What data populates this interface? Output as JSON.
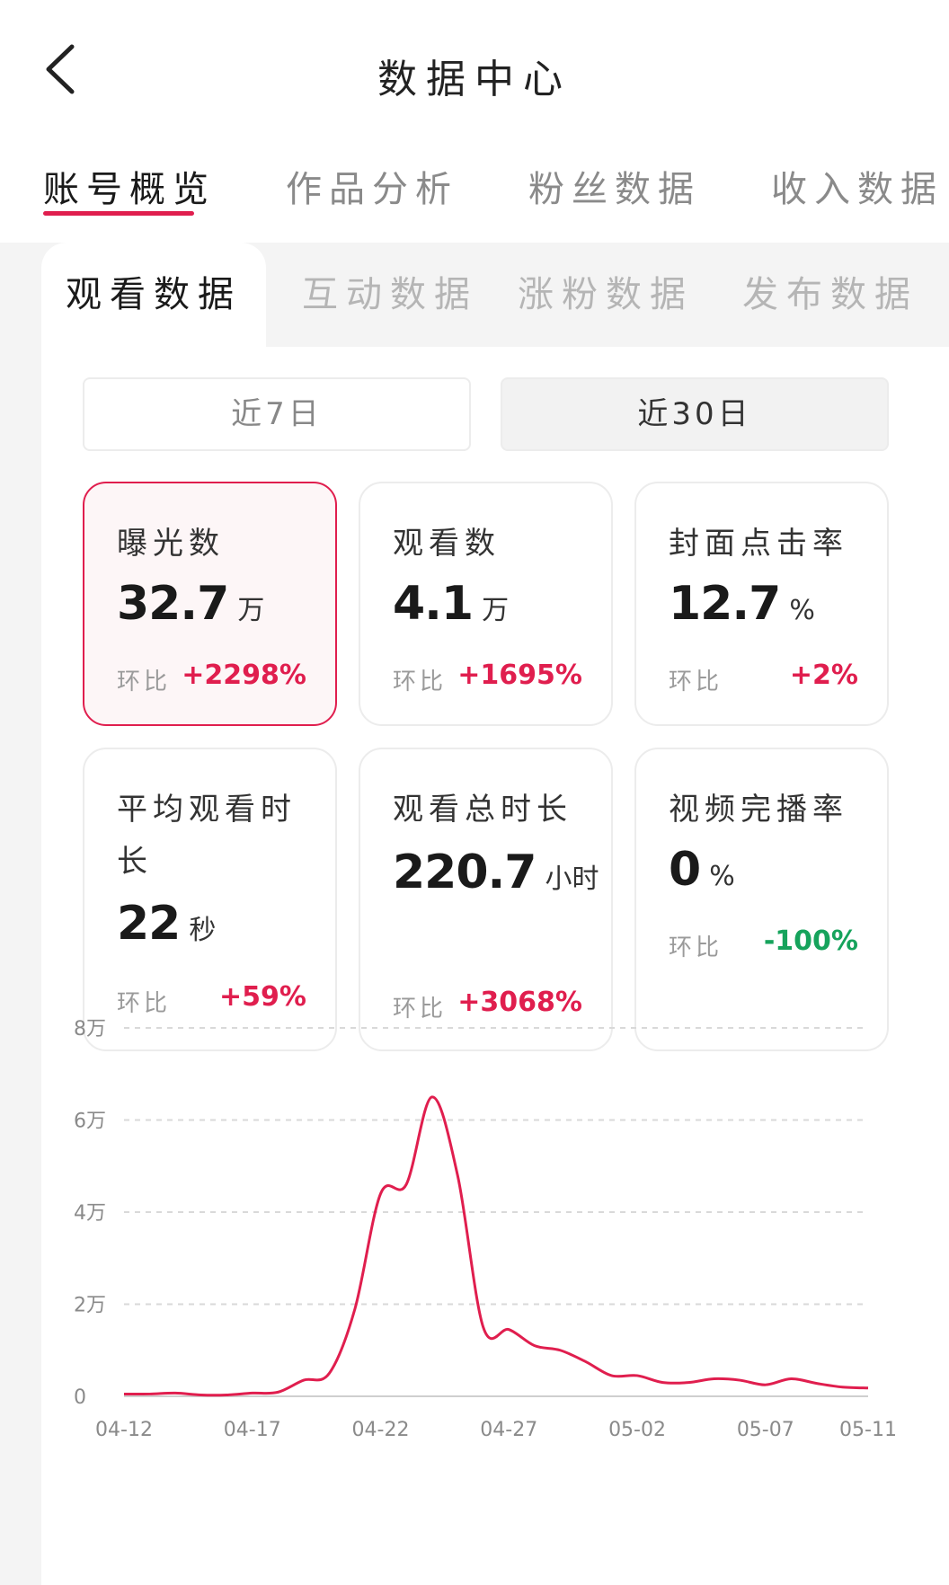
{
  "header": {
    "title": "数据中心"
  },
  "main_tabs": [
    {
      "label": "账号概览",
      "active": true
    },
    {
      "label": "作品分析",
      "active": false
    },
    {
      "label": "粉丝数据",
      "active": false
    },
    {
      "label": "收入数据",
      "active": false
    }
  ],
  "sub_tabs": [
    {
      "label": "观看数据",
      "active": true
    },
    {
      "label": "互动数据",
      "active": false
    },
    {
      "label": "涨粉数据",
      "active": false
    },
    {
      "label": "发布数据",
      "active": false
    }
  ],
  "range": {
    "option_7": "近7日",
    "option_30": "近30日",
    "selected": "近30日"
  },
  "metrics": [
    {
      "label": "曝光数",
      "value": "32.7",
      "unit": "万",
      "compare_label": "环比",
      "change": "+2298%",
      "selected": true
    },
    {
      "label": "观看数",
      "value": "4.1",
      "unit": "万",
      "compare_label": "环比",
      "change": "+1695%"
    },
    {
      "label": "封面点击率",
      "value": "12.7",
      "unit": "%",
      "compare_label": "环比",
      "change": "+2%"
    },
    {
      "label": "平均观看时长",
      "value": "22",
      "unit": "秒",
      "compare_label": "环比",
      "change": "+59%"
    },
    {
      "label": "观看总时长",
      "value": "220.7",
      "unit": "小时",
      "compare_label": "环比",
      "change": "+3068%"
    },
    {
      "label": "视频完播率",
      "value": "0",
      "unit": "%",
      "compare_label": "环比",
      "change": "-100%"
    }
  ],
  "colors": {
    "accent": "#e01e4e",
    "negative": "#16a35c",
    "grid": "#d9d9d9"
  },
  "chart_data": {
    "type": "line",
    "ylim": [
      0,
      80000
    ],
    "y_ticks": [
      {
        "value": 0,
        "label": "0"
      },
      {
        "value": 20000,
        "label": "2万"
      },
      {
        "value": 40000,
        "label": "4万"
      },
      {
        "value": 60000,
        "label": "6万"
      },
      {
        "value": 80000,
        "label": "8万"
      }
    ],
    "x_tick_labels": [
      "04-12",
      "04-17",
      "04-22",
      "04-27",
      "05-02",
      "05-07",
      "05-11"
    ],
    "grid": true,
    "series": [
      {
        "x": [
          "04-12",
          "04-13",
          "04-14",
          "04-15",
          "04-16",
          "04-17",
          "04-18",
          "04-19",
          "04-20",
          "04-21",
          "04-22",
          "04-23",
          "04-24",
          "04-25",
          "04-26",
          "04-27",
          "04-28",
          "04-29",
          "04-30",
          "05-01",
          "05-02",
          "05-03",
          "05-04",
          "05-05",
          "05-06",
          "05-07",
          "05-08",
          "05-09",
          "05-10",
          "05-11"
        ],
        "y": [
          500,
          500,
          700,
          300,
          300,
          700,
          900,
          3500,
          5000,
          19000,
          44000,
          46000,
          65000,
          48000,
          15000,
          14500,
          11000,
          10000,
          7500,
          4500,
          4500,
          3000,
          3000,
          3800,
          3500,
          2500,
          3800,
          2800,
          2000,
          1800
        ]
      }
    ]
  }
}
